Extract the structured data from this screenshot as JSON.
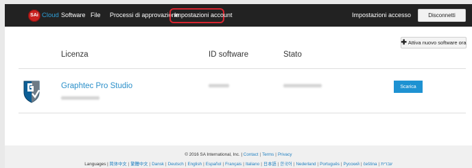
{
  "topbar": {
    "logo_badge": "SAi",
    "logo_text": "Cloud",
    "nav": [
      "Software",
      "File",
      "Processi di approvazione",
      "Impostazioni account"
    ],
    "login_settings": "Impostazioni accesso",
    "disconnect": "Disconnetti",
    "highlight_color": "#d8242f"
  },
  "main": {
    "activate_button": "Attiva nuovo software ora",
    "activate_icon": "plus-icon",
    "columns": {
      "license": "Licenza",
      "software_id": "ID software",
      "status": "Stato"
    },
    "row": {
      "app_icon": "graphtec-shield-icon",
      "name": "Graphtec Pro Studio",
      "download": "Scarica",
      "link_color": "#2a8fc9",
      "button_color": "#1e92d2"
    }
  },
  "footer": {
    "copyright_prefix": "© 2016 SA International, Inc. |",
    "links": [
      "Contact",
      "Terms",
      "Privacy"
    ],
    "languages_label": "Languages |",
    "languages": [
      "简体中文",
      "繁體中文",
      "Dansk",
      "Deutsch",
      "English",
      "Español",
      "Français",
      "Italiano",
      "日本語",
      "한국어",
      "Nederland",
      "Português",
      "Русский",
      "čeština",
      "עברית"
    ]
  }
}
